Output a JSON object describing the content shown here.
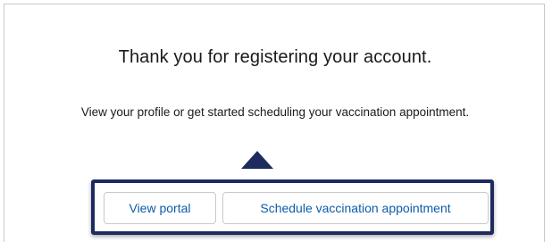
{
  "message": {
    "heading": "Thank you for registering your account.",
    "subtext": "View your profile or get started scheduling your vaccination appointment."
  },
  "actions": {
    "view_portal_label": "View portal",
    "schedule_label": "Schedule vaccination appointment"
  },
  "colors": {
    "accent": "#1d2b5e",
    "link": "#0b5cab",
    "border": "#c9c9c9"
  },
  "icons": {
    "pointer": "up-arrow-pointer-icon"
  }
}
